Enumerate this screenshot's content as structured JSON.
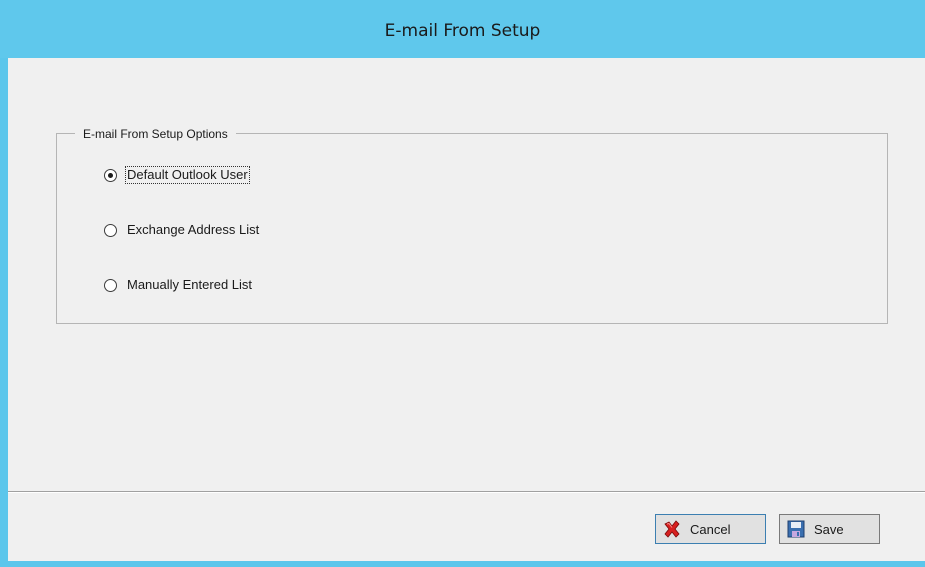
{
  "window": {
    "title": "E-mail From Setup",
    "accent_color": "#5bc6eb"
  },
  "group": {
    "legend": "E-mail From Setup Options",
    "options": [
      {
        "label": "Default Outlook User",
        "selected": true
      },
      {
        "label": "Exchange Address List",
        "selected": false
      },
      {
        "label": "Manually Entered List",
        "selected": false
      }
    ]
  },
  "footer": {
    "cancel_label": "Cancel",
    "cancel_icon": "red-x-icon",
    "save_label": "Save",
    "save_icon": "floppy-disk-icon"
  }
}
